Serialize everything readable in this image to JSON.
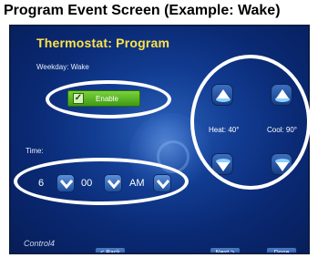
{
  "caption": "Program Event Screen (Example: Wake)",
  "screen": {
    "title": "Thermostat: Program",
    "subtitle": "Weekday: Wake",
    "enable": {
      "label": "Enable",
      "checked": true
    },
    "time": {
      "label": "Time:",
      "hour": "6",
      "minute": "00",
      "ampm": "AM"
    },
    "setpoints": {
      "heat_label": "Heat: 40°",
      "cool_label": "Cool: 90°"
    },
    "nav": {
      "back": "< Back",
      "next": "Next >",
      "done": "Done"
    },
    "brand": "Control4"
  },
  "colors": {
    "title": "#ffe24a",
    "enable_green": "#4caf1a",
    "screen_blue": "#0a2a75",
    "highlight": "#ffffff"
  }
}
